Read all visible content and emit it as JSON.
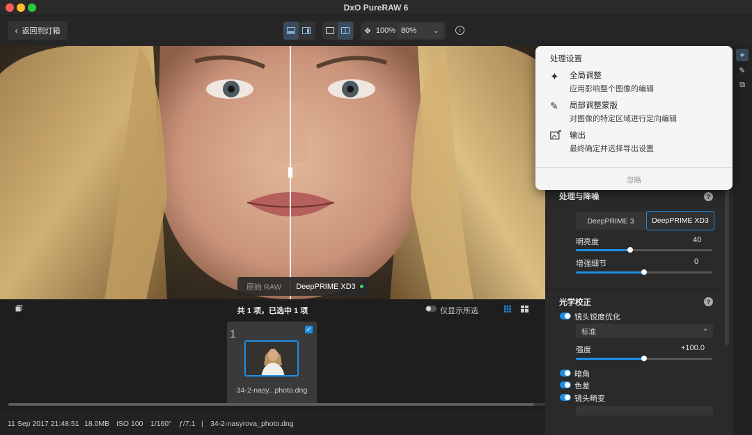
{
  "window": {
    "title": "DxO PureRAW 6"
  },
  "toolbar": {
    "back_label": "返回到灯箱",
    "zoom_fit": "100%",
    "zoom_value": "80%"
  },
  "viewer": {
    "left_label": "原始 RAW",
    "right_label": "DeepPRIME XD3"
  },
  "filmstrip": {
    "summary": "共 1 项，已选中 1 项",
    "filter_label": "仅显示所选",
    "item_index": "1",
    "item_name": "34-2-nasy...photo.dng"
  },
  "status": {
    "date": "11 Sep 2017 21:48:51",
    "size": "18.0MB",
    "iso": "ISO 100",
    "shutter": "1/160\"",
    "aperture": "ƒ/7.1",
    "sep": "|",
    "filename": "34-2-nasyrova_photo.dng"
  },
  "popup": {
    "title": "处理设置",
    "items": [
      {
        "title": "全局调整",
        "desc": "应用影响整个图像的编辑",
        "icon": "sparkles-icon"
      },
      {
        "title": "局部调整蒙版",
        "desc": "对图像的特定区域进行定向编辑",
        "icon": "brush-mask-icon"
      },
      {
        "title": "输出",
        "desc": "最终确定并选择导出设置",
        "icon": "export-image-icon"
      }
    ],
    "dismiss": "忽略"
  },
  "panel": {
    "denoise": {
      "title": "处理与降噪",
      "tab_a": "DeepPRIME 3",
      "tab_b": "DeepPRIME XD3",
      "brightness": {
        "label": "明亮度",
        "value": "40",
        "fraction": 0.4
      },
      "detail": {
        "label": "增强细节",
        "value": "0",
        "fraction": 0.5
      }
    },
    "optics": {
      "title": "光学校正",
      "sharpen_label": "镜头锐度优化",
      "preset": "标准",
      "strength": {
        "label": "强度",
        "value": "+100.0",
        "fraction": 0.5
      },
      "vignetting": "暗角",
      "chromatic": "色差",
      "distortion": "镜头畸变"
    }
  },
  "colors": {
    "accent": "#1e8fe6",
    "panel": "#2a2a2a",
    "popup": "#f4f4f4"
  }
}
